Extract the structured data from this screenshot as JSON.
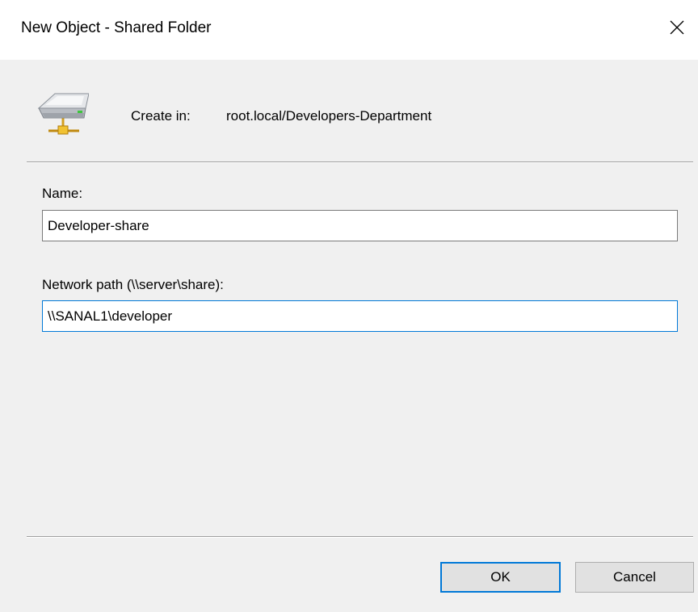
{
  "window": {
    "title": "New Object - Shared Folder"
  },
  "header": {
    "icon": "shared-folder-icon",
    "create_in_label": "Create in:",
    "create_in_value": "root.local/Developers-Department"
  },
  "form": {
    "name_label": "Name:",
    "name_value": "Developer-share",
    "path_label": "Network path (\\\\server\\share):",
    "path_value": "\\\\SANAL1\\developer"
  },
  "buttons": {
    "ok_label": "OK",
    "cancel_label": "Cancel"
  },
  "colors": {
    "accent": "#0078d7",
    "dialog_background": "#f0f0f0",
    "title_background": "#ffffff"
  }
}
